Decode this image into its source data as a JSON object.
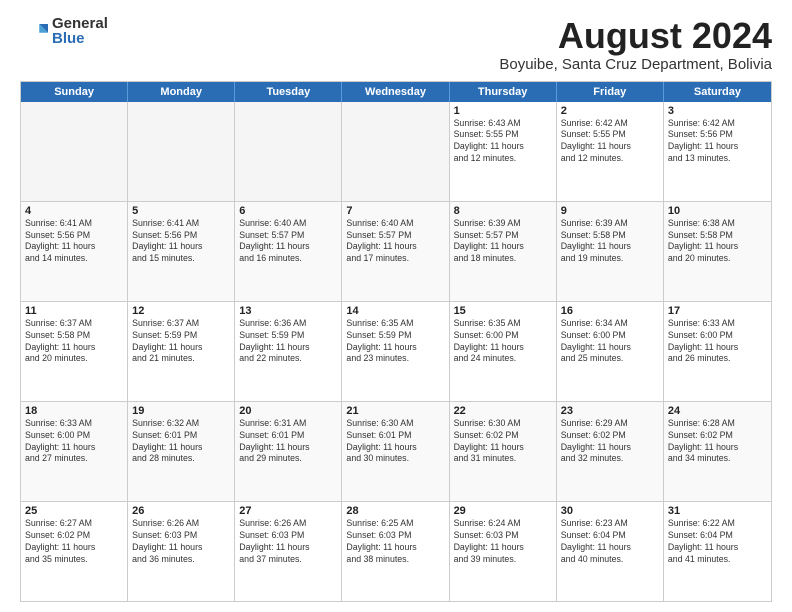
{
  "logo": {
    "general": "General",
    "blue": "Blue"
  },
  "title": "August 2024",
  "subtitle": "Boyuibe, Santa Cruz Department, Bolivia",
  "headers": [
    "Sunday",
    "Monday",
    "Tuesday",
    "Wednesday",
    "Thursday",
    "Friday",
    "Saturday"
  ],
  "weeks": [
    [
      {
        "day": "",
        "info": "",
        "empty": true
      },
      {
        "day": "",
        "info": "",
        "empty": true
      },
      {
        "day": "",
        "info": "",
        "empty": true
      },
      {
        "day": "",
        "info": "",
        "empty": true
      },
      {
        "day": "1",
        "info": "Sunrise: 6:43 AM\nSunset: 5:55 PM\nDaylight: 11 hours\nand 12 minutes."
      },
      {
        "day": "2",
        "info": "Sunrise: 6:42 AM\nSunset: 5:55 PM\nDaylight: 11 hours\nand 12 minutes."
      },
      {
        "day": "3",
        "info": "Sunrise: 6:42 AM\nSunset: 5:56 PM\nDaylight: 11 hours\nand 13 minutes."
      }
    ],
    [
      {
        "day": "4",
        "info": "Sunrise: 6:41 AM\nSunset: 5:56 PM\nDaylight: 11 hours\nand 14 minutes."
      },
      {
        "day": "5",
        "info": "Sunrise: 6:41 AM\nSunset: 5:56 PM\nDaylight: 11 hours\nand 15 minutes."
      },
      {
        "day": "6",
        "info": "Sunrise: 6:40 AM\nSunset: 5:57 PM\nDaylight: 11 hours\nand 16 minutes."
      },
      {
        "day": "7",
        "info": "Sunrise: 6:40 AM\nSunset: 5:57 PM\nDaylight: 11 hours\nand 17 minutes."
      },
      {
        "day": "8",
        "info": "Sunrise: 6:39 AM\nSunset: 5:57 PM\nDaylight: 11 hours\nand 18 minutes."
      },
      {
        "day": "9",
        "info": "Sunrise: 6:39 AM\nSunset: 5:58 PM\nDaylight: 11 hours\nand 19 minutes."
      },
      {
        "day": "10",
        "info": "Sunrise: 6:38 AM\nSunset: 5:58 PM\nDaylight: 11 hours\nand 20 minutes."
      }
    ],
    [
      {
        "day": "11",
        "info": "Sunrise: 6:37 AM\nSunset: 5:58 PM\nDaylight: 11 hours\nand 20 minutes."
      },
      {
        "day": "12",
        "info": "Sunrise: 6:37 AM\nSunset: 5:59 PM\nDaylight: 11 hours\nand 21 minutes."
      },
      {
        "day": "13",
        "info": "Sunrise: 6:36 AM\nSunset: 5:59 PM\nDaylight: 11 hours\nand 22 minutes."
      },
      {
        "day": "14",
        "info": "Sunrise: 6:35 AM\nSunset: 5:59 PM\nDaylight: 11 hours\nand 23 minutes."
      },
      {
        "day": "15",
        "info": "Sunrise: 6:35 AM\nSunset: 6:00 PM\nDaylight: 11 hours\nand 24 minutes."
      },
      {
        "day": "16",
        "info": "Sunrise: 6:34 AM\nSunset: 6:00 PM\nDaylight: 11 hours\nand 25 minutes."
      },
      {
        "day": "17",
        "info": "Sunrise: 6:33 AM\nSunset: 6:00 PM\nDaylight: 11 hours\nand 26 minutes."
      }
    ],
    [
      {
        "day": "18",
        "info": "Sunrise: 6:33 AM\nSunset: 6:00 PM\nDaylight: 11 hours\nand 27 minutes."
      },
      {
        "day": "19",
        "info": "Sunrise: 6:32 AM\nSunset: 6:01 PM\nDaylight: 11 hours\nand 28 minutes."
      },
      {
        "day": "20",
        "info": "Sunrise: 6:31 AM\nSunset: 6:01 PM\nDaylight: 11 hours\nand 29 minutes."
      },
      {
        "day": "21",
        "info": "Sunrise: 6:30 AM\nSunset: 6:01 PM\nDaylight: 11 hours\nand 30 minutes."
      },
      {
        "day": "22",
        "info": "Sunrise: 6:30 AM\nSunset: 6:02 PM\nDaylight: 11 hours\nand 31 minutes."
      },
      {
        "day": "23",
        "info": "Sunrise: 6:29 AM\nSunset: 6:02 PM\nDaylight: 11 hours\nand 32 minutes."
      },
      {
        "day": "24",
        "info": "Sunrise: 6:28 AM\nSunset: 6:02 PM\nDaylight: 11 hours\nand 34 minutes."
      }
    ],
    [
      {
        "day": "25",
        "info": "Sunrise: 6:27 AM\nSunset: 6:02 PM\nDaylight: 11 hours\nand 35 minutes."
      },
      {
        "day": "26",
        "info": "Sunrise: 6:26 AM\nSunset: 6:03 PM\nDaylight: 11 hours\nand 36 minutes."
      },
      {
        "day": "27",
        "info": "Sunrise: 6:26 AM\nSunset: 6:03 PM\nDaylight: 11 hours\nand 37 minutes."
      },
      {
        "day": "28",
        "info": "Sunrise: 6:25 AM\nSunset: 6:03 PM\nDaylight: 11 hours\nand 38 minutes."
      },
      {
        "day": "29",
        "info": "Sunrise: 6:24 AM\nSunset: 6:03 PM\nDaylight: 11 hours\nand 39 minutes."
      },
      {
        "day": "30",
        "info": "Sunrise: 6:23 AM\nSunset: 6:04 PM\nDaylight: 11 hours\nand 40 minutes."
      },
      {
        "day": "31",
        "info": "Sunrise: 6:22 AM\nSunset: 6:04 PM\nDaylight: 11 hours\nand 41 minutes."
      }
    ]
  ]
}
